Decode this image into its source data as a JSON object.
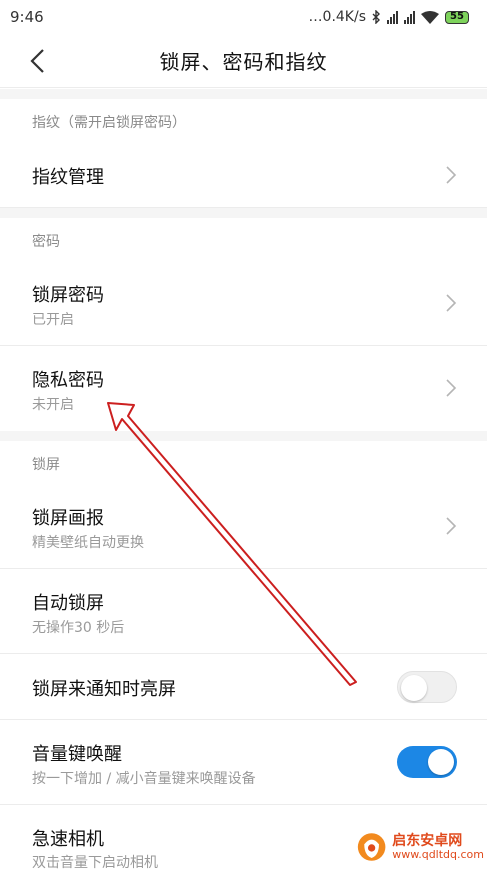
{
  "status_bar": {
    "time": "9:46",
    "speed": "…0.4K/s",
    "battery": "55"
  },
  "header": {
    "title": "锁屏、密码和指纹"
  },
  "sections": {
    "fingerprint": {
      "label": "指纹（需开启锁屏密码）",
      "items": [
        {
          "label": "指纹管理"
        }
      ]
    },
    "password": {
      "label": "密码",
      "items": [
        {
          "label": "锁屏密码",
          "sub": "已开启"
        },
        {
          "label": "隐私密码",
          "sub": "未开启"
        }
      ]
    },
    "lockscreen": {
      "label": "锁屏",
      "items": [
        {
          "label": "锁屏画报",
          "sub": "精美壁纸自动更换"
        },
        {
          "label": "自动锁屏",
          "sub": "无操作30 秒后"
        },
        {
          "label": "锁屏来通知时亮屏",
          "toggle": "off"
        },
        {
          "label": "音量键唤醒",
          "sub": "按一下增加 / 减小音量键来唤醒设备",
          "toggle": "on"
        },
        {
          "label": "急速相机",
          "sub": "双击音量下启动相机"
        }
      ]
    }
  },
  "watermark": {
    "name": "启东安卓网",
    "url": "www.qdltdq.com"
  },
  "colors": {
    "accent": "#1c87e5",
    "annotation_arrow": "#cc1f1f",
    "section_bg": "#f5f5f5"
  }
}
